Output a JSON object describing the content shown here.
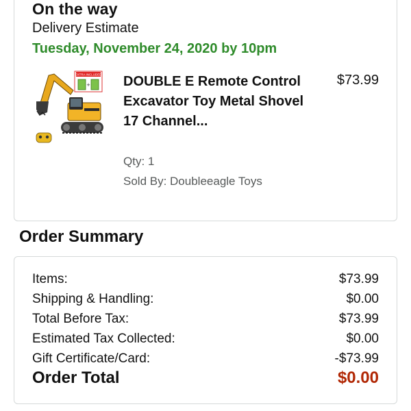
{
  "shipment": {
    "status": "On the way",
    "delivery_label": "Delivery Estimate",
    "delivery_date": "Tuesday, November 24, 2020 by 10pm",
    "delivery_date_color": "#2e8b2a"
  },
  "product": {
    "title": "DOUBLE E Remote Control Excavator Toy Metal Shovel 17 Channel...",
    "price": "$73.99",
    "qty": "Qty: 1",
    "seller": "Sold By: Doubleeagle Toys",
    "image_badge": "EXTRA INCLUDED"
  },
  "summary": {
    "heading": "Order Summary",
    "rows": [
      {
        "label": "Items:",
        "value": "$73.99"
      },
      {
        "label": "Shipping & Handling:",
        "value": "$0.00"
      },
      {
        "label": "Total Before Tax:",
        "value": "$73.99"
      },
      {
        "label": "Estimated Tax Collected:",
        "value": "$0.00"
      },
      {
        "label": "Gift Certificate/Card:",
        "value": "-$73.99"
      }
    ],
    "total_label": "Order Total",
    "total_value": "$0.00",
    "total_color": "#b12704"
  }
}
